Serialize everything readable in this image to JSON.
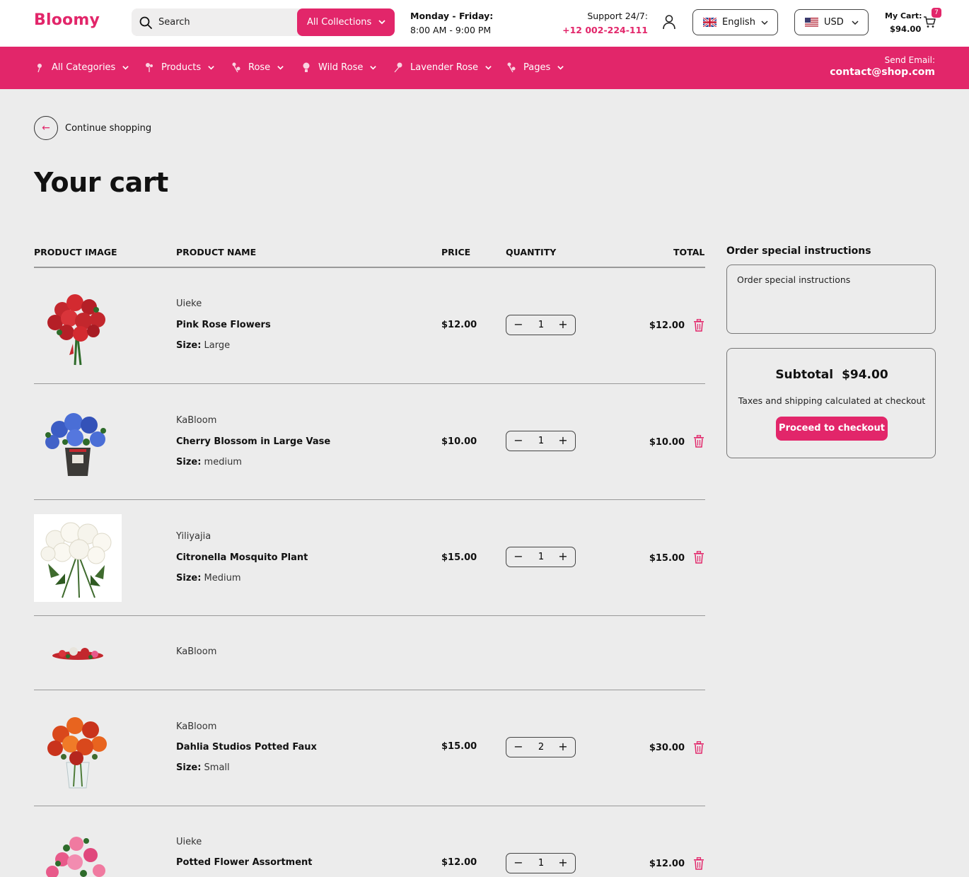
{
  "header": {
    "logo": "Bloomy",
    "search_placeholder": "Search",
    "collections_label": "All Collections",
    "hours_days": "Monday - Friday:",
    "hours_time": "8:00 AM - 9:00 PM",
    "support_label": "Support 24/7:",
    "support_phone": "+12 002-224-111",
    "language": "English",
    "currency": "USD",
    "cart_label": "My Cart:",
    "cart_total": "$94.00",
    "cart_count": "7"
  },
  "nav": {
    "items": [
      {
        "label": "All Categories"
      },
      {
        "label": "Products"
      },
      {
        "label": "Rose"
      },
      {
        "label": "Wild Rose"
      },
      {
        "label": "Lavender Rose"
      },
      {
        "label": "Pages"
      }
    ],
    "send_email_label": "Send Email:",
    "email": "contact@shop.com"
  },
  "content": {
    "continue_label": "Continue shopping",
    "title": "Your cart",
    "columns": {
      "image": "PRODUCT IMAGE",
      "name": "PRODUCT NAME",
      "price": "PRICE",
      "quantity": "QUANTITY",
      "total": "TOTAL"
    },
    "size_label": "Size:",
    "items": [
      {
        "vendor": "Uieke",
        "name": "Pink Rose Flowers",
        "size": "Large",
        "price": "$12.00",
        "qty": "1",
        "total": "$12.00",
        "image": "red-rose-bouquet"
      },
      {
        "vendor": "KaBloom",
        "name": "Cherry Blossom in Large Vase",
        "size": "medium",
        "price": "$10.00",
        "qty": "1",
        "total": "$10.00",
        "image": "blue-hydrangea-pot"
      },
      {
        "vendor": "Yiliyajia",
        "name": "Citronella Mosquito Plant",
        "size": "Medium",
        "price": "$15.00",
        "qty": "1",
        "total": "$15.00",
        "image": "white-rose-bouquet"
      },
      {
        "vendor": "KaBloom",
        "image": "red-flower-arrangement"
      },
      {
        "vendor": "KaBloom",
        "name": "Dahlia Studios Potted Faux",
        "size": "Small",
        "price": "$15.00",
        "qty": "2",
        "total": "$30.00",
        "image": "orange-flower-vase"
      },
      {
        "vendor": "Uieke",
        "name": "Potted Flower Assortment",
        "price": "$12.00",
        "qty": "1",
        "total": "$12.00",
        "image": "pink-flower-bouquet"
      }
    ]
  },
  "sidebar": {
    "instructions_title": "Order special instructions",
    "instructions_placeholder": "Order special instructions",
    "subtotal_label": "Subtotal",
    "subtotal_value": "$94.00",
    "tax_note": "Taxes and shipping calculated at checkout",
    "checkout_label": "Proceed to checkout"
  },
  "colors": {
    "accent": "#e2266a",
    "background": "#ececec",
    "delete_icon": "#e2266a"
  },
  "icons": [
    "search-icon",
    "chevron-down-icon",
    "user-icon",
    "uk-flag-icon",
    "us-flag-icon",
    "cart-icon",
    "flower-icon",
    "arrow-left-icon",
    "minus-icon",
    "plus-icon",
    "trash-icon"
  ]
}
